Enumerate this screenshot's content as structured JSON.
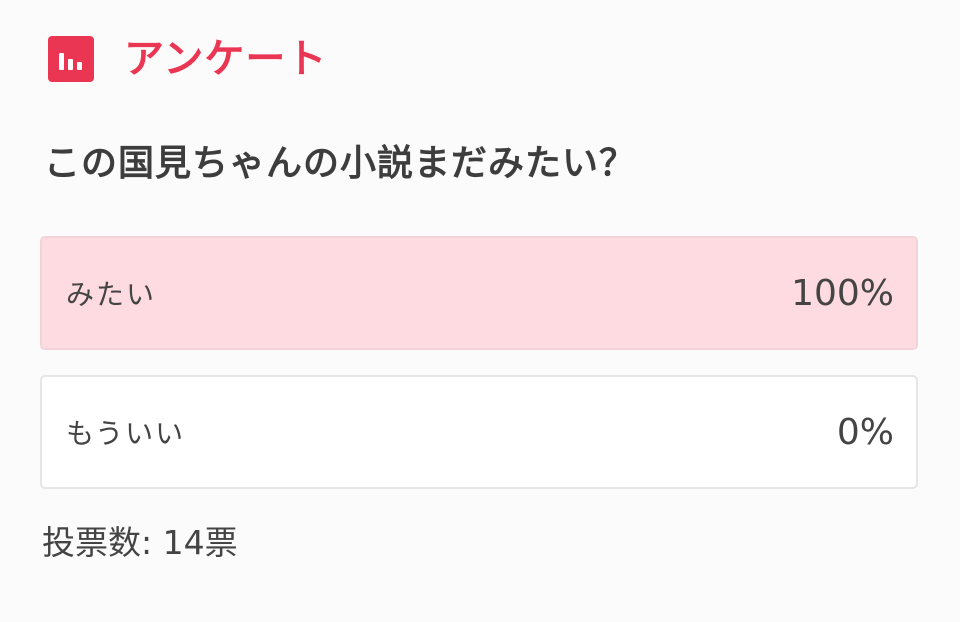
{
  "header": {
    "icon": "bar-chart-icon",
    "title": "アンケート",
    "accent_color": "#ea3652"
  },
  "poll": {
    "question": "この国見ちゃんの小説まだみたい？",
    "options": [
      {
        "label": "みたい",
        "percent_label": "100%",
        "percent": 100
      },
      {
        "label": "もういい",
        "percent_label": "0%",
        "percent": 0
      }
    ],
    "votes_label": "投票数: 14票",
    "fill_color": "#fddbe0"
  }
}
